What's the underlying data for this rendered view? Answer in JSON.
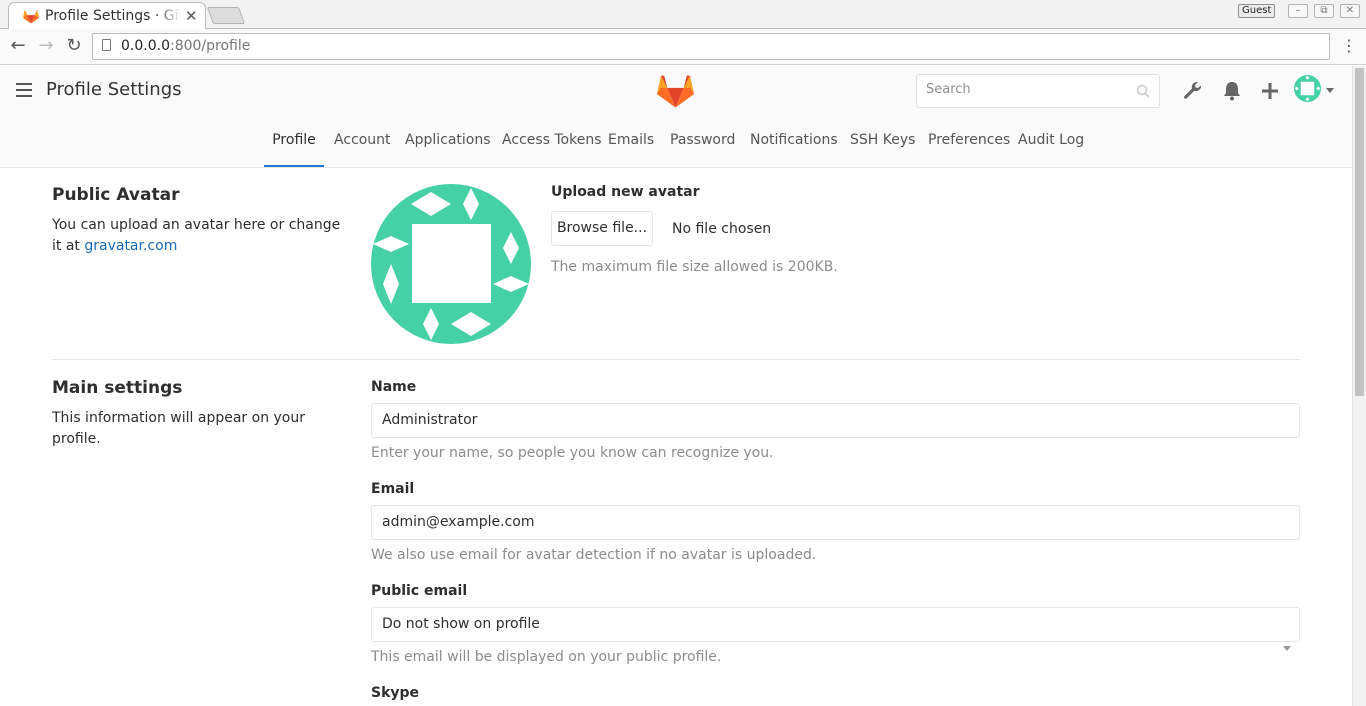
{
  "browser": {
    "tab_title": "Profile Settings · GitLab",
    "tab_close": "✕",
    "guest_label": "Guest",
    "url_host": "0.0.0.0",
    "url_rest": ":800/profile"
  },
  "header": {
    "title": "Profile Settings",
    "search_placeholder": "Search"
  },
  "subnav": {
    "tabs": [
      {
        "label": "Profile",
        "active": true
      },
      {
        "label": "Account"
      },
      {
        "label": "Applications"
      },
      {
        "label": "Access Tokens"
      },
      {
        "label": "Emails"
      },
      {
        "label": "Password"
      },
      {
        "label": "Notifications"
      },
      {
        "label": "SSH Keys"
      },
      {
        "label": "Preferences"
      },
      {
        "label": "Audit Log"
      }
    ]
  },
  "avatar_section": {
    "title": "Public Avatar",
    "desc": "You can upload an avatar here or change it at",
    "link": "gravatar.com",
    "upload_label": "Upload new avatar",
    "browse_label": "Browse file...",
    "no_file": "No file chosen",
    "max_size": "The maximum file size allowed is 200KB.",
    "avatar_color": "#45d1a5"
  },
  "main_section": {
    "title": "Main settings",
    "desc": "This information will appear on your profile.",
    "name_label": "Name",
    "name_value": "Administrator",
    "name_help": "Enter your name, so people you know can recognize you.",
    "email_label": "Email",
    "email_value": "admin@example.com",
    "email_help": "We also use email for avatar detection if no avatar is uploaded.",
    "public_email_label": "Public email",
    "public_email_value": "Do not show on profile",
    "public_email_help": "This email will be displayed on your public profile.",
    "skype_label": "Skype"
  },
  "colors": {
    "accent": "#1f78d1",
    "link": "#1b69b6"
  }
}
